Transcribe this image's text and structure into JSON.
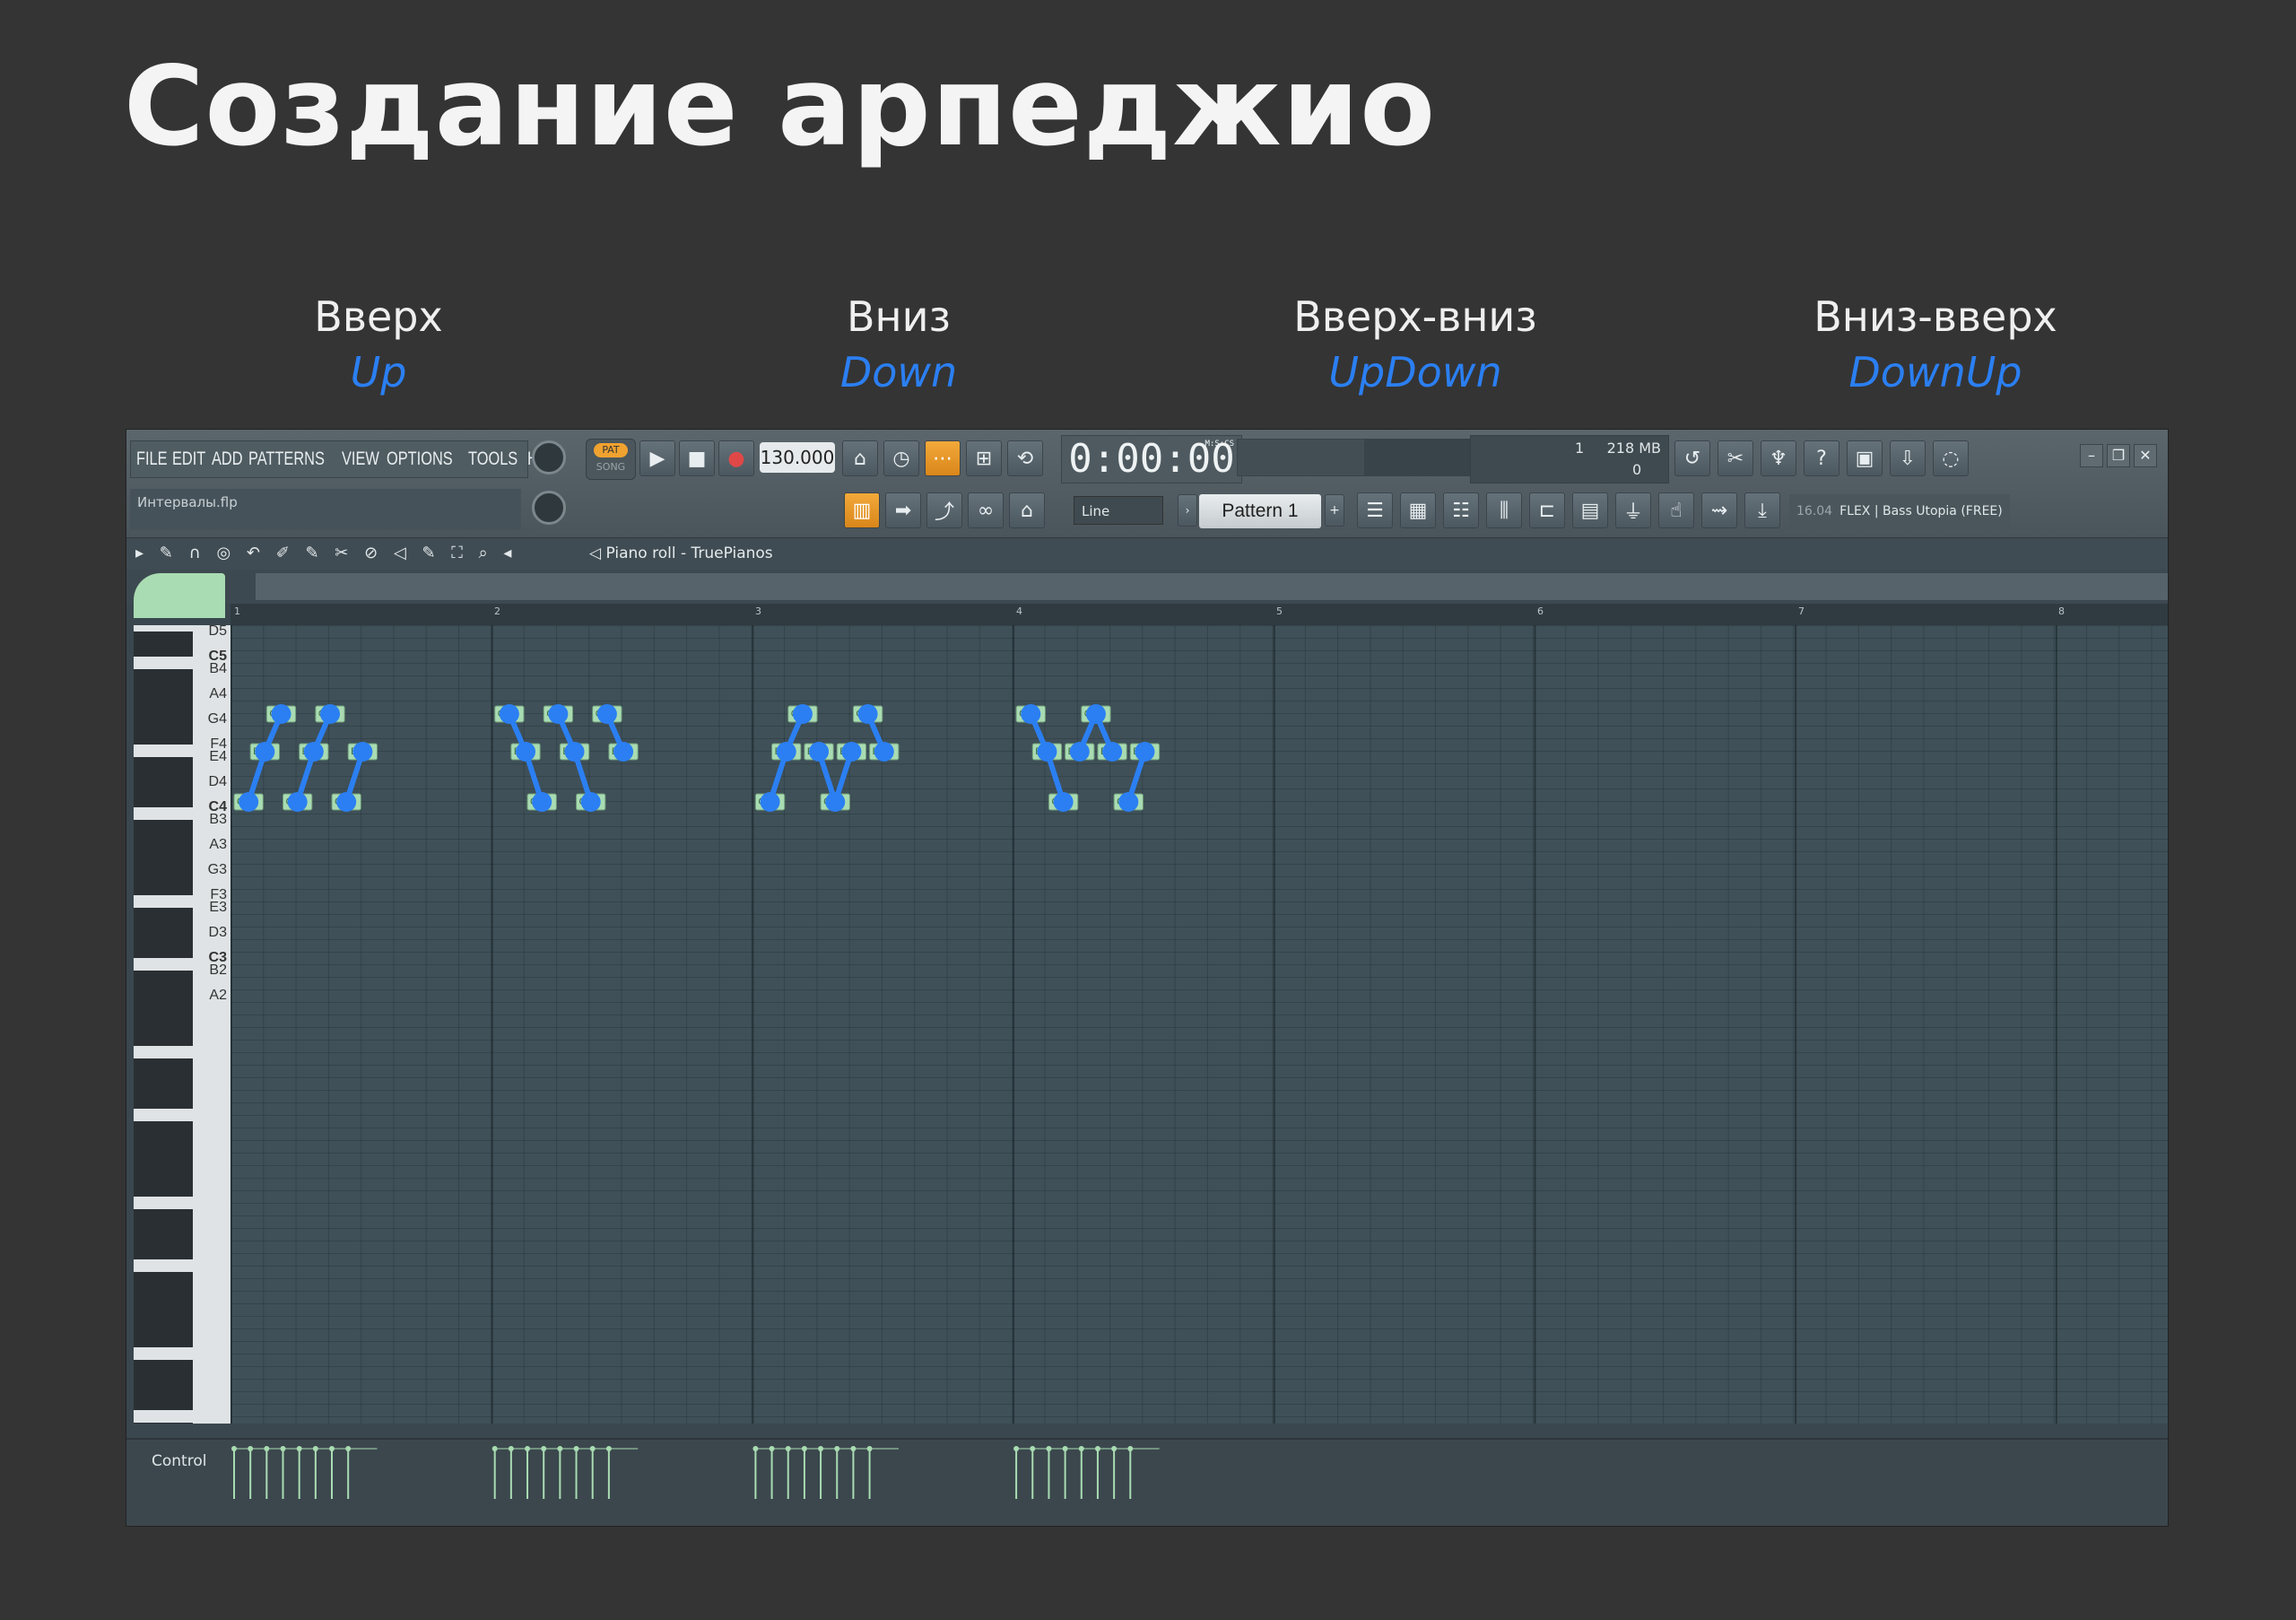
{
  "title": "Создание арпеджио",
  "patterns": [
    {
      "ru": "Вверх",
      "en": "Up"
    },
    {
      "ru": "Вниз",
      "en": "Down"
    },
    {
      "ru": "Вверх-вниз",
      "en": "UpDown"
    },
    {
      "ru": "Вниз-вверх",
      "en": "DownUp"
    }
  ],
  "app": {
    "menu": [
      "FILE",
      "EDIT",
      "ADD",
      "PATTERNS",
      "VIEW",
      "OPTIONS",
      "TOOLS",
      "HELP"
    ],
    "project_name": "Интервалы.flp",
    "pat_label": "PAT",
    "song_label": "SONG",
    "tempo": "130.000",
    "time": "0:00:00",
    "time_unit": "M:S:CS",
    "cpu_value": "1",
    "memory": "218 MB",
    "polyphony": "0",
    "snap_mode": "Line",
    "pattern": "Pattern 1",
    "plugin_hint_time": "16.04",
    "plugin_hint": "FLEX | Bass Utopia (FREE)",
    "piano_roll_title": "Piano roll - TruePianos",
    "control_label": "Control",
    "accent_color": "#2b7ff2",
    "note_color": "#a9dcb2"
  },
  "piano_roll": {
    "bar_numbers": [
      "1",
      "2",
      "3",
      "4",
      "5",
      "6",
      "7",
      "8"
    ],
    "key_labels": [
      "D5",
      "C5",
      "B4",
      "A4",
      "G4",
      "F4",
      "E4",
      "D4",
      "C4",
      "B3",
      "A3",
      "G3",
      "F3",
      "E3",
      "D3",
      "C3",
      "B2",
      "A2"
    ],
    "note_labels": {
      "C4": "C4",
      "E4": "E4",
      "G4": "G4"
    },
    "arpeggios": [
      {
        "name": "Up",
        "notes": [
          [
            "C4",
            0
          ],
          [
            "E4",
            0.5
          ],
          [
            "G4",
            1
          ],
          [
            "C4",
            1.5
          ],
          [
            "E4",
            2
          ],
          [
            "G4",
            2.5
          ],
          [
            "C4",
            3
          ],
          [
            "E4",
            3.5
          ]
        ]
      },
      {
        "name": "Down",
        "notes": [
          [
            "G4",
            8
          ],
          [
            "E4",
            8.5
          ],
          [
            "C4",
            9
          ],
          [
            "G4",
            9.5
          ],
          [
            "E4",
            10
          ],
          [
            "C4",
            10.5
          ],
          [
            "G4",
            11
          ],
          [
            "E4",
            11.5
          ]
        ]
      },
      {
        "name": "UpDown",
        "notes": [
          [
            "C4",
            16
          ],
          [
            "E4",
            16.5
          ],
          [
            "G4",
            17
          ],
          [
            "E4",
            17.5
          ],
          [
            "C4",
            18
          ],
          [
            "E4",
            18.5
          ],
          [
            "G4",
            19
          ],
          [
            "E4",
            19.5
          ]
        ]
      },
      {
        "name": "DownUp",
        "notes": [
          [
            "G4",
            24
          ],
          [
            "E4",
            24.5
          ],
          [
            "C4",
            25
          ],
          [
            "E4",
            25.5
          ],
          [
            "G4",
            26
          ],
          [
            "E4",
            26.5
          ],
          [
            "C4",
            27
          ],
          [
            "E4",
            27.5
          ]
        ]
      }
    ]
  }
}
